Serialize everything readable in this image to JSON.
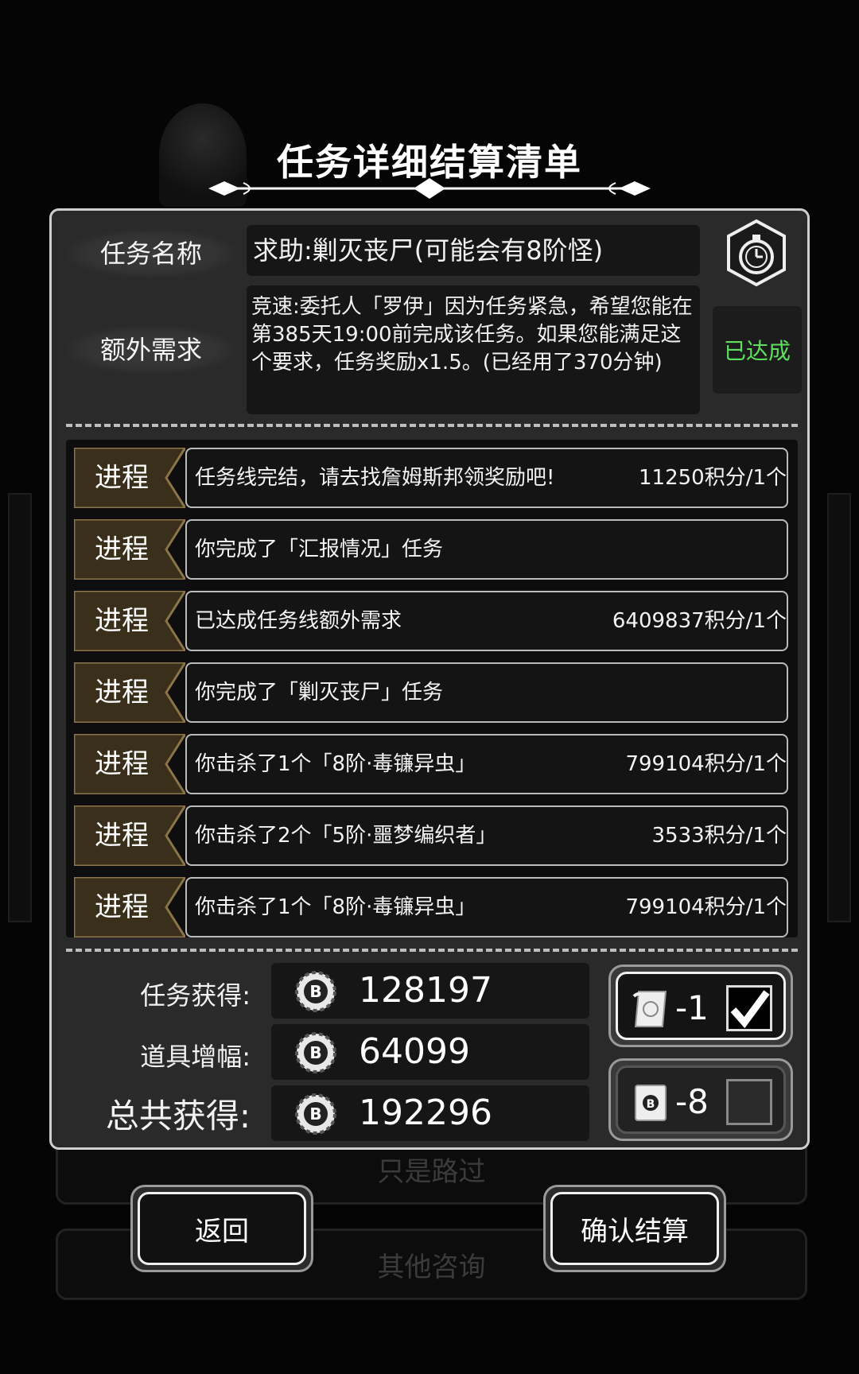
{
  "background": {
    "buttons": [
      "只是路过",
      "其他咨询"
    ]
  },
  "title": "任务详细结算清单",
  "task": {
    "name_label": "任务名称",
    "name": "求助:剿灭丧尸(可能会有8阶怪)",
    "extra_label": "额外需求",
    "extra_text": "竞速:委托人「罗伊」因为任务紧急，希望您能在第385天19:00前完成该任务。如果您能满足这个要求，任务奖励x1.5。(已经用了370分钟)",
    "status": "已达成",
    "status_color": "#5ee05e",
    "icon": "stopwatch-icon"
  },
  "progress_items": [
    {
      "tag": "进程",
      "text": "任务线完结，请去找詹姆斯邦领奖励吧!",
      "reward": "11250积分/1个"
    },
    {
      "tag": "进程",
      "text": "你完成了「汇报情况」任务",
      "reward": ""
    },
    {
      "tag": "进程",
      "text": "已达成任务线额外需求",
      "reward": "6409837积分/1个"
    },
    {
      "tag": "进程",
      "text": "你完成了「剿灭丧尸」任务",
      "reward": ""
    },
    {
      "tag": "进程",
      "text": "你击杀了1个「8阶·毒镰异虫」",
      "reward": "799104积分/1个"
    },
    {
      "tag": "进程",
      "text": "你击杀了2个「5阶·噩梦编织者」",
      "reward": "3533积分/1个"
    },
    {
      "tag": "进程",
      "text": "你击杀了1个「8阶·毒镰异虫」",
      "reward": "799104积分/1个"
    }
  ],
  "summary": {
    "task_label": "任务获得:",
    "task_value": "128197",
    "item_label": "道具增幅:",
    "item_value": "64099",
    "total_label": "总共获得:",
    "total_value": "192296",
    "coin_icon": "bitcoin-coin-icon"
  },
  "options": [
    {
      "count": "-1",
      "checked": true,
      "icon": "scroll-ticket-icon"
    },
    {
      "count": "-8",
      "checked": false,
      "icon": "card-ticket-icon"
    }
  ],
  "buttons": {
    "back": "返回",
    "confirm": "确认结算"
  }
}
